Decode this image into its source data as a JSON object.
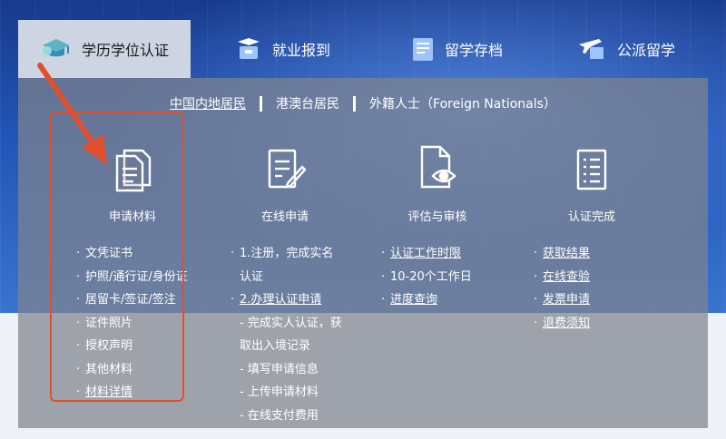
{
  "tabs": [
    {
      "label": "学历学位认证",
      "icon": "graduation-cap-icon",
      "active": true
    },
    {
      "label": "就业报到",
      "icon": "briefcase-icon",
      "active": false
    },
    {
      "label": "留学存档",
      "icon": "document-folder-icon",
      "active": false
    },
    {
      "label": "公派留学",
      "icon": "airplane-icon",
      "active": false
    }
  ],
  "subnav": [
    {
      "label": "中国内地居民",
      "active": true
    },
    {
      "label": "港澳台居民",
      "active": false
    },
    {
      "label": "外籍人士（Foreign Nationals）",
      "active": false
    }
  ],
  "steps": [
    {
      "label": "申请材料",
      "icon": "documents-icon"
    },
    {
      "label": "在线申请",
      "icon": "edit-form-icon"
    },
    {
      "label": "评估与审核",
      "icon": "review-eye-icon"
    },
    {
      "label": "认证完成",
      "icon": "checklist-icon"
    }
  ],
  "lists": {
    "materials": [
      "文凭证书",
      "护照/通行证/身份证",
      "居留卡/签证/签注",
      "证件照片",
      "授权声明",
      "其他材料",
      "材料详情"
    ],
    "apply": [
      "1.注册，完成实名",
      "认证",
      "2.办理认证申请",
      "- 完成实人认证，获",
      "取出入境记录",
      "- 填写申请信息",
      "- 上传申请材料",
      "- 在线支付费用"
    ],
    "review": [
      "认证工作时限",
      "10-20个工作日",
      "进度查询"
    ],
    "complete": [
      "获取结果",
      "在线查验",
      "发票申请",
      "退费须知"
    ]
  },
  "colors": {
    "annotation": "#e0502f",
    "active_tab": "#d7dce6",
    "banner": "#2256b8"
  }
}
